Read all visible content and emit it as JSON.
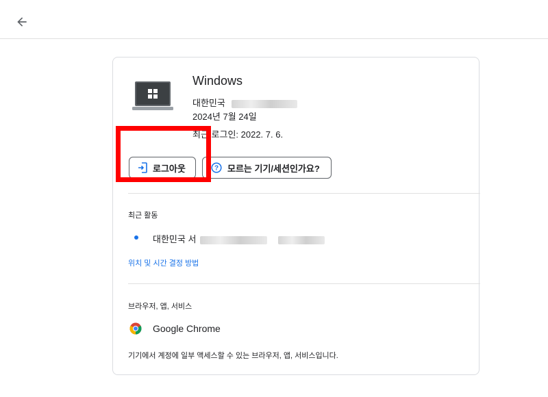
{
  "topbar": {
    "back_icon": "arrow-left-icon"
  },
  "device": {
    "name": "Windows",
    "location_prefix": "대한민국",
    "date": "2024년 7월 24일",
    "last_login": "최근 로그인: 2022. 7. 6."
  },
  "actions": {
    "logout_label": "로그아웃",
    "unknown_label": "모르는 기기/세션인가요?"
  },
  "recent_activity": {
    "title": "최근 활동",
    "location_prefix": "대한민국 서",
    "how_link": "위치 및 시간 결정 방법"
  },
  "browsers": {
    "title": "브라우저, 앱, 서비스",
    "items": [
      {
        "name": "Google Chrome",
        "icon": "chrome-icon"
      }
    ],
    "footer": "기기에서 계정에 일부 액세스할 수 있는 브라우저, 앱, 서비스입니다."
  },
  "colors": {
    "accent": "#1a73e8",
    "highlight": "#ff0000",
    "divider": "#e0e0e0"
  }
}
